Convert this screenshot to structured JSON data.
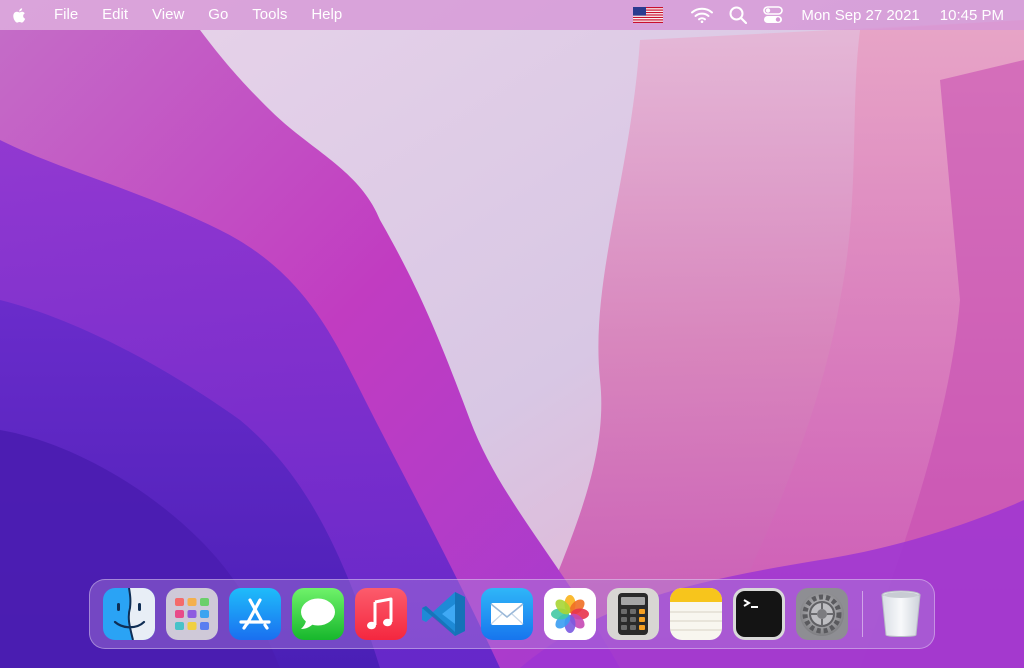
{
  "menubar": {
    "apple_icon": "apple-icon",
    "menus": [
      {
        "label": "File"
      },
      {
        "label": "Edit"
      },
      {
        "label": "View"
      },
      {
        "label": "Go"
      },
      {
        "label": "Tools"
      },
      {
        "label": "Help"
      }
    ],
    "status": {
      "input_source_icon": "us-flag-icon",
      "wifi_icon": "wifi-icon",
      "search_icon": "search-icon",
      "control_center_icon": "control-center-icon",
      "date": "Mon Sep 27 2021",
      "time": "10:45 PM"
    }
  },
  "dock": {
    "apps": [
      {
        "name": "Finder",
        "icon": "finder-icon"
      },
      {
        "name": "Launchpad",
        "icon": "launchpad-icon"
      },
      {
        "name": "App Store",
        "icon": "app-store-icon"
      },
      {
        "name": "Messages",
        "icon": "messages-icon"
      },
      {
        "name": "Music",
        "icon": "music-icon"
      },
      {
        "name": "Visual Studio Code",
        "icon": "vscode-icon"
      },
      {
        "name": "Mail",
        "icon": "mail-icon"
      },
      {
        "name": "Photos",
        "icon": "photos-icon"
      },
      {
        "name": "Calculator",
        "icon": "calculator-icon"
      },
      {
        "name": "Notes",
        "icon": "notes-icon"
      },
      {
        "name": "Terminal",
        "icon": "terminal-icon"
      },
      {
        "name": "System Preferences",
        "icon": "system-preferences-icon"
      }
    ],
    "trash": {
      "name": "Trash",
      "icon": "trash-icon"
    }
  },
  "colors": {
    "menubar_bg": "#d696d6",
    "wallpaper_violet": "#6c2fd6",
    "wallpaper_magenta": "#c23dbd",
    "wallpaper_light": "#d9cde6"
  }
}
